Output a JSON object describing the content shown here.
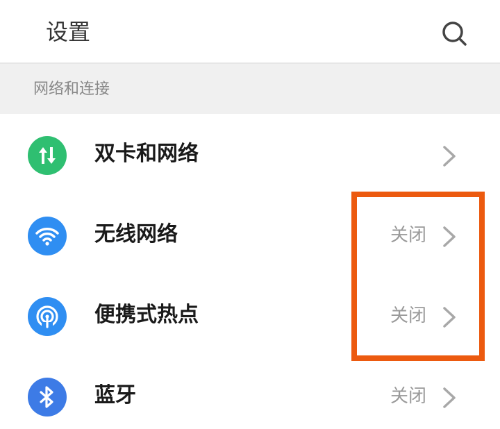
{
  "header": {
    "title": "设置",
    "search_icon": "search-icon"
  },
  "section": {
    "title": "网络和连接"
  },
  "rows": [
    {
      "label": "双卡和网络",
      "status": "",
      "icon": "data-transfer-icon",
      "icon_color": "#2fbf71"
    },
    {
      "label": "无线网络",
      "status": "关闭",
      "icon": "wifi-icon",
      "icon_color": "#2f8ef2"
    },
    {
      "label": "便携式热点",
      "status": "关闭",
      "icon": "hotspot-icon",
      "icon_color": "#2f8ef2"
    },
    {
      "label": "蓝牙",
      "status": "关闭",
      "icon": "bluetooth-icon",
      "icon_color": "#3d7be6"
    }
  ],
  "colors": {
    "highlight": "#ec5a0f",
    "text_primary": "#1a1a1a",
    "text_secondary": "#9a9a9a"
  }
}
